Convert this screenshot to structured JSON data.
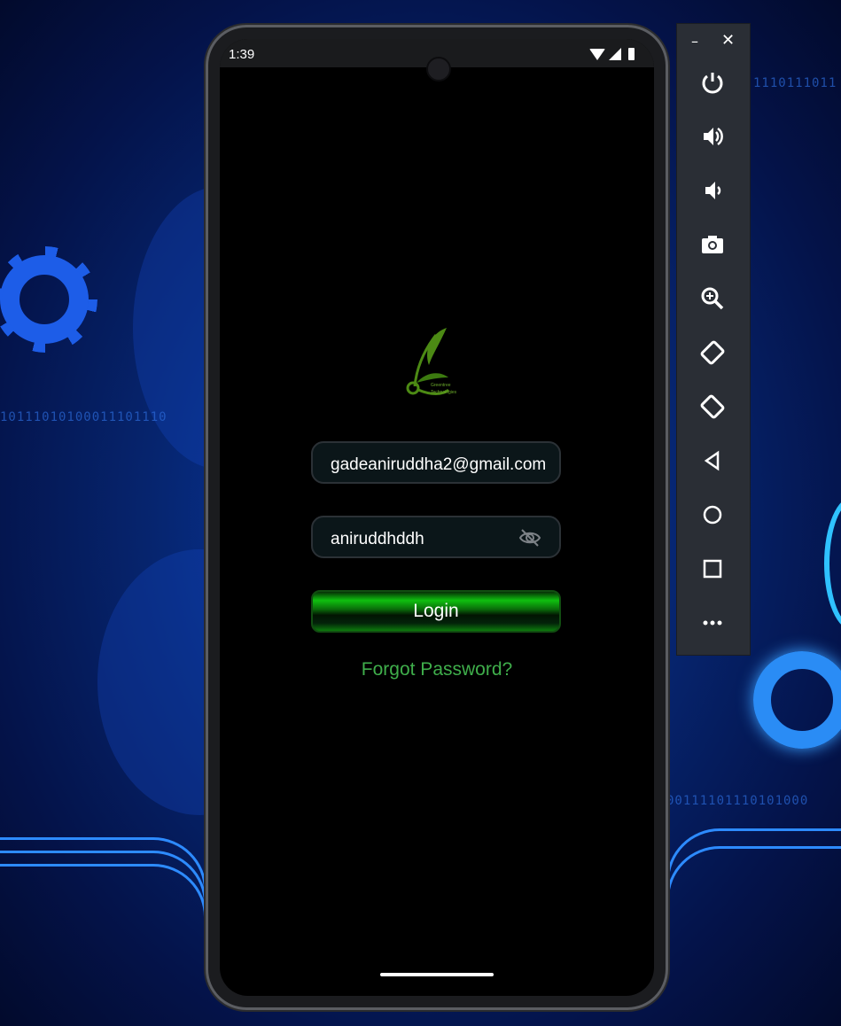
{
  "status_bar": {
    "time": "1:39"
  },
  "login": {
    "email_value": "gadeaniruddha2@gmail.com",
    "password_value": "aniruddhddh",
    "login_label": "Login",
    "forgot_label": "Forgot Password?"
  },
  "logo": {
    "line1": "Greentree",
    "line2": "Technologies"
  },
  "background": {
    "binary_1": "10111010100011101110",
    "binary_2": "1110111011",
    "binary_3": "00111101110101000"
  },
  "toolbar": {
    "minimize": "–",
    "close": "✕",
    "buttons": [
      "power-icon",
      "volume-up-icon",
      "volume-down-icon",
      "camera-icon",
      "zoom-icon",
      "rotate-left-icon",
      "rotate-right-icon",
      "back-icon",
      "home-icon",
      "overview-icon",
      "more-icon"
    ]
  },
  "colors": {
    "accent_green": "#3fae4b",
    "button_green": "#0fc00f"
  }
}
